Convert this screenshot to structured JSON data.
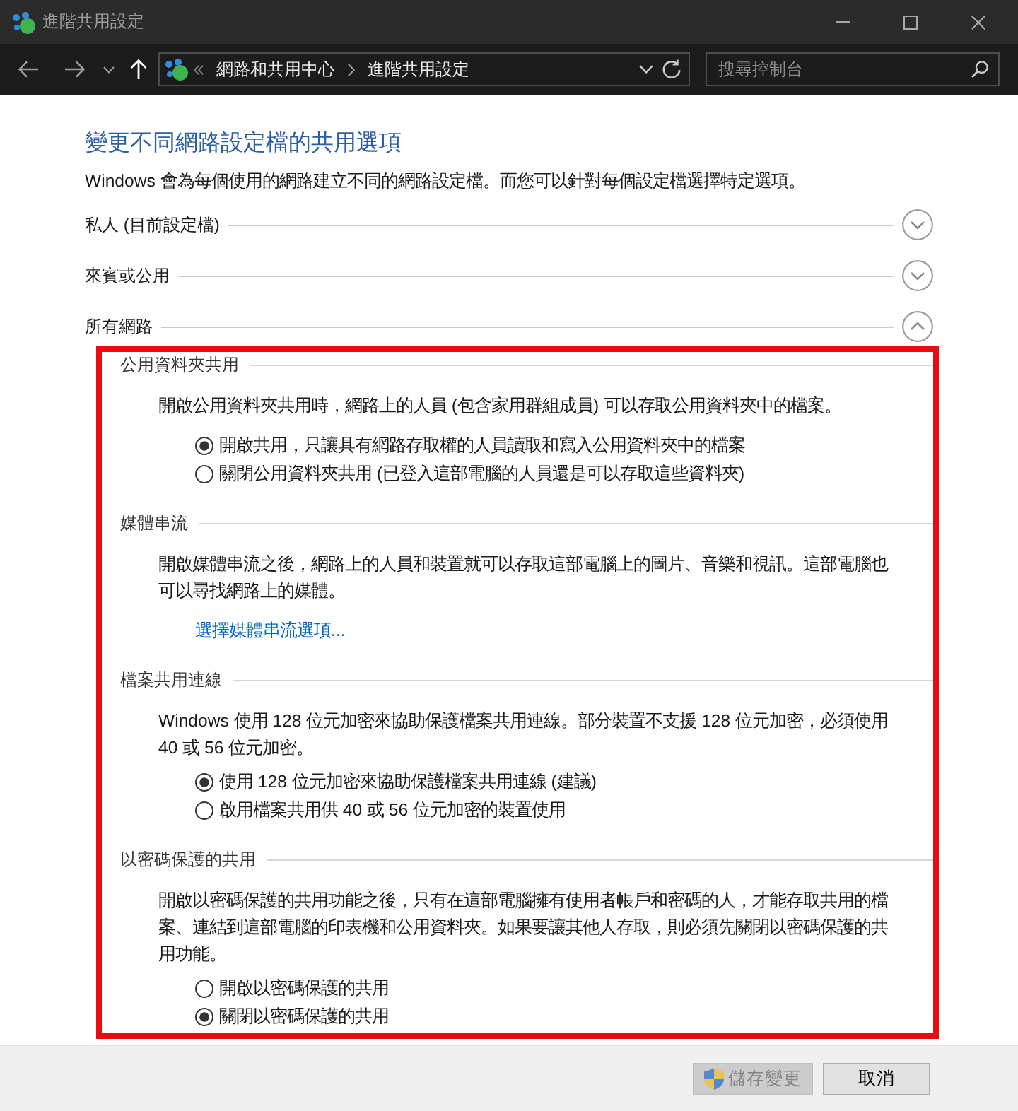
{
  "window": {
    "title": "進階共用設定"
  },
  "address_bar": {
    "breadcrumbs": [
      "網路和共用中心",
      "進階共用設定"
    ]
  },
  "search": {
    "placeholder": "搜尋控制台"
  },
  "heading": "變更不同網路設定檔的共用選項",
  "description": "Windows 會為每個使用的網路建立不同的網路設定檔。而您可以針對每個設定檔選擇特定選項。",
  "profiles": [
    {
      "label": "私人 (目前設定檔)",
      "expanded": false
    },
    {
      "label": "來賓或公用",
      "expanded": false
    },
    {
      "label": "所有網路",
      "expanded": true,
      "highlighted": true,
      "sections": [
        {
          "title": "公用資料夾共用",
          "text": "開啟公用資料夾共用時，網路上的人員 (包含家用群組成員) 可以存取公用資料夾中的檔案。",
          "options": [
            {
              "label": "開啟共用，只讓具有網路存取權的人員讀取和寫入公用資料夾中的檔案",
              "selected": true
            },
            {
              "label": "關閉公用資料夾共用 (已登入這部電腦的人員還是可以存取這些資料夾)",
              "selected": false
            }
          ]
        },
        {
          "title": "媒體串流",
          "text": "開啟媒體串流之後，網路上的人員和裝置就可以存取這部電腦上的圖片、音樂和視訊。這部電腦也可以尋找網路上的媒體。",
          "link": "選擇媒體串流選項..."
        },
        {
          "title": "檔案共用連線",
          "text": "Windows 使用 128 位元加密來協助保護檔案共用連線。部分裝置不支援 128 位元加密，必須使用 40 或 56 位元加密。",
          "options": [
            {
              "label": "使用 128 位元加密來協助保護檔案共用連線 (建議)",
              "selected": true
            },
            {
              "label": "啟用檔案共用供 40 或 56 位元加密的裝置使用",
              "selected": false
            }
          ]
        },
        {
          "title": "以密碼保護的共用",
          "text": "開啟以密碼保護的共用功能之後，只有在這部電腦擁有使用者帳戶和密碼的人，才能存取共用的檔案、連結到這部電腦的印表機和公用資料夾。如果要讓其他人存取，則必須先關閉以密碼保護的共用功能。",
          "options": [
            {
              "label": "開啟以密碼保護的共用",
              "selected": false
            },
            {
              "label": "關閉以密碼保護的共用",
              "selected": true
            }
          ]
        }
      ]
    }
  ],
  "buttons": [
    {
      "label": "儲存變更",
      "kind": "elevated",
      "disabled": true
    },
    {
      "label": "取消",
      "kind": "plain",
      "disabled": false
    }
  ]
}
